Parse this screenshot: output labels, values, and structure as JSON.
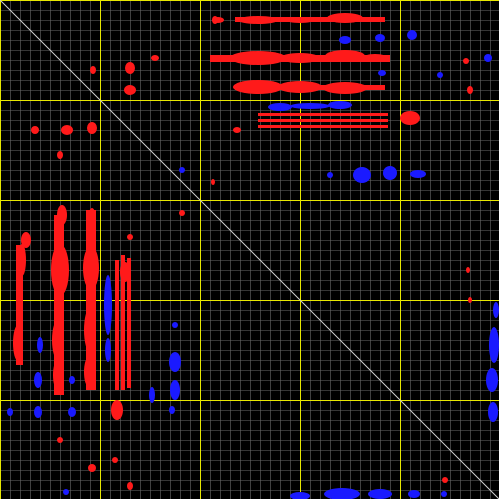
{
  "view": {
    "background_color": "#000000",
    "fine_grid_color": "#6b6b6b",
    "major_grid_color": "#e8e800",
    "diagonal_color": "#cfcfcf",
    "positive_color": "#ff1a1a",
    "negative_color": "#1a1aff"
  },
  "grid": {
    "fine_divisions": 50,
    "major_every": 10
  }
}
